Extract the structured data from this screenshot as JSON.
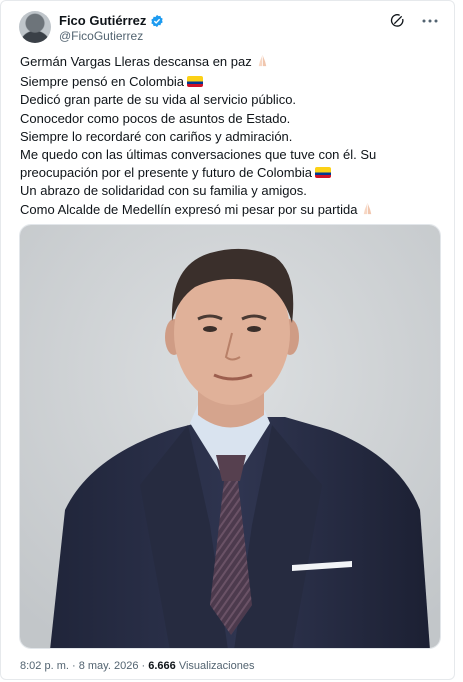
{
  "author": {
    "name": "Fico Gutiérrez",
    "handle": "@FicoGutierrez",
    "verified": true
  },
  "icons": {
    "grok": "grok-icon",
    "more": "more-options-icon",
    "verified": "verified-badge-icon",
    "pray": "folded-hands-icon",
    "flag": "colombia-flag-icon"
  },
  "tweet": {
    "lines": [
      {
        "text": "Germán Vargas Lleras descansa en paz",
        "emoji": "pray"
      },
      {
        "text": "Siempre pensó en Colombia",
        "emoji": "flag"
      },
      {
        "text": "Dedicó gran parte de su vida al servicio público.",
        "emoji": ""
      },
      {
        "text": "Conocedor como pocos de asuntos de Estado.",
        "emoji": ""
      },
      {
        "text": "Siempre lo recordaré con cariños y admiración.",
        "emoji": ""
      },
      {
        "text": "Me quedo con las últimas conversaciones que tuve con él. Su",
        "emoji": ""
      },
      {
        "text": "preocupación por el presente y futuro de Colombia",
        "emoji": "flag"
      },
      {
        "text": "Un abrazo de solidaridad con su familia y amigos.",
        "emoji": ""
      },
      {
        "text": "Como Alcalde de Medellín expresó mi pesar por su partida",
        "emoji": "pray"
      }
    ]
  },
  "meta": {
    "time": "8:02 p. m.",
    "separator": "·",
    "date": "8 may. 2026",
    "views_count": "6.666",
    "views_label": "Visualizaciones"
  },
  "colors": {
    "text": "#0f1419",
    "secondary": "#536471",
    "verified": "#1d9bf0",
    "photo_bg": "#cfd2d4",
    "suit": "#2a2f3e",
    "tie": "#4b3a48",
    "shirt": "#d9e3ef"
  }
}
